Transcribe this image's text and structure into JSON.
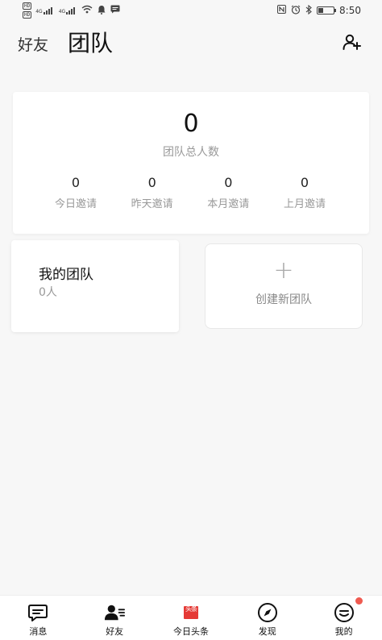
{
  "status_bar": {
    "sim1": "HD",
    "sim2": "HD",
    "network1": "4G",
    "network2": "4G",
    "time": "8:50"
  },
  "header": {
    "tab_friends": "好友",
    "tab_team": "团队"
  },
  "summary": {
    "total_count": "0",
    "total_label": "团队总人数",
    "stats": [
      {
        "value": "0",
        "label": "今日邀请"
      },
      {
        "value": "0",
        "label": "昨天邀请"
      },
      {
        "value": "0",
        "label": "本月邀请"
      },
      {
        "value": "0",
        "label": "上月邀请"
      }
    ]
  },
  "my_team": {
    "title": "我的团队",
    "count": "0人"
  },
  "create_team": {
    "plus": "+",
    "label": "创建新团队"
  },
  "tabbar": {
    "items": [
      {
        "label": "消息",
        "icon": "message-icon"
      },
      {
        "label": "好友",
        "icon": "friends-icon"
      },
      {
        "label": "今日头条",
        "icon": "toutiao-icon",
        "logo_text": "头条"
      },
      {
        "label": "发现",
        "icon": "compass-icon"
      },
      {
        "label": "我的",
        "icon": "profile-icon"
      }
    ]
  },
  "colors": {
    "accent_red": "#ef5a50",
    "toutiao_red": "#e53935"
  }
}
